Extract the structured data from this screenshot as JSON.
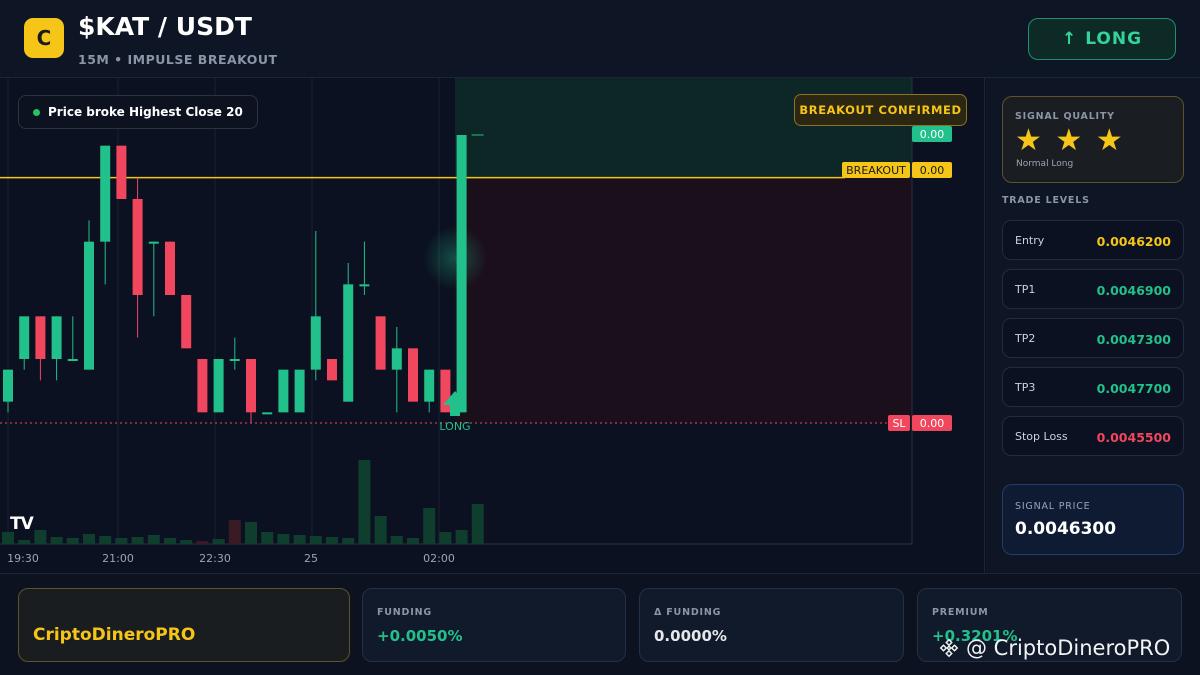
{
  "header": {
    "logo_letter": "C",
    "pair": "$KAT / USDT",
    "subtitle": "15M • IMPULSE BREAKOUT",
    "action_button": {
      "arrow": "↑",
      "label": "LONG"
    }
  },
  "chart": {
    "note": "Price broke Highest Close 20",
    "badge": "BREAKOUT CONFIRMED",
    "tv_logo": "TV",
    "tags": {
      "top_value": "0.00",
      "breakout_label": "BREAKOUT",
      "breakout_value": "0.00",
      "sl_label": "SL",
      "sl_value": "0.00"
    },
    "signal_marker_label": "LONG",
    "x_ticks": [
      "19:30",
      "21:00",
      "22:30",
      "25",
      "02:00"
    ],
    "colors": {
      "up": "#22c08a",
      "down": "#f0475e",
      "breakout_line": "#f5c518",
      "sl_line": "#f0475e"
    }
  },
  "chart_data": {
    "type": "candlestick",
    "x_ticks": [
      "19:30",
      "21:00",
      "22:30",
      "25",
      "02:00"
    ],
    "candles": [
      {
        "o": 0.00457,
        "h": 0.0046,
        "l": 0.00456,
        "c": 0.0046,
        "dir": "up"
      },
      {
        "o": 0.00461,
        "h": 0.00464,
        "l": 0.0046,
        "c": 0.00465,
        "dir": "up"
      },
      {
        "o": 0.00465,
        "h": 0.00465,
        "l": 0.00459,
        "c": 0.00461,
        "dir": "down"
      },
      {
        "o": 0.00461,
        "h": 0.00465,
        "l": 0.00459,
        "c": 0.00465,
        "dir": "up"
      },
      {
        "o": 0.00461,
        "h": 0.00465,
        "l": 0.00461,
        "c": 0.00461,
        "dir": "up"
      },
      {
        "o": 0.0046,
        "h": 0.00474,
        "l": 0.0046,
        "c": 0.00472,
        "dir": "up"
      },
      {
        "o": 0.00472,
        "h": 0.0048,
        "l": 0.00468,
        "c": 0.00481,
        "dir": "up"
      },
      {
        "o": 0.00481,
        "h": 0.00481,
        "l": 0.00476,
        "c": 0.00476,
        "dir": "down"
      },
      {
        "o": 0.00476,
        "h": 0.00478,
        "l": 0.00463,
        "c": 0.00467,
        "dir": "down"
      },
      {
        "o": 0.00472,
        "h": 0.00472,
        "l": 0.00465,
        "c": 0.00472,
        "dir": "up"
      },
      {
        "o": 0.00472,
        "h": 0.00472,
        "l": 0.00467,
        "c": 0.00467,
        "dir": "down"
      },
      {
        "o": 0.00467,
        "h": 0.00467,
        "l": 0.00462,
        "c": 0.00462,
        "dir": "down"
      },
      {
        "o": 0.00461,
        "h": 0.00461,
        "l": 0.00459,
        "c": 0.00456,
        "dir": "down"
      },
      {
        "o": 0.00461,
        "h": 0.00461,
        "l": 0.0046,
        "c": 0.00456,
        "dir": "up"
      },
      {
        "o": 0.00461,
        "h": 0.00463,
        "l": 0.0046,
        "c": 0.00461,
        "dir": "up"
      },
      {
        "o": 0.00461,
        "h": 0.00461,
        "l": 0.00455,
        "c": 0.00456,
        "dir": "down"
      },
      {
        "o": 0.00456,
        "h": 0.00456,
        "l": 0.00456,
        "c": 0.00456,
        "dir": "up"
      },
      {
        "o": 0.00456,
        "h": 0.0046,
        "l": 0.00456,
        "c": 0.0046,
        "dir": "up"
      },
      {
        "o": 0.00456,
        "h": 0.0046,
        "l": 0.00456,
        "c": 0.0046,
        "dir": "up"
      },
      {
        "o": 0.0046,
        "h": 0.00473,
        "l": 0.00459,
        "c": 0.00465,
        "dir": "up"
      },
      {
        "o": 0.00461,
        "h": 0.00461,
        "l": 0.00459,
        "c": 0.00459,
        "dir": "down"
      },
      {
        "o": 0.00457,
        "h": 0.0047,
        "l": 0.00457,
        "c": 0.00468,
        "dir": "up"
      },
      {
        "o": 0.00468,
        "h": 0.00472,
        "l": 0.00467,
        "c": 0.00468,
        "dir": "up"
      },
      {
        "o": 0.00465,
        "h": 0.00465,
        "l": 0.0046,
        "c": 0.0046,
        "dir": "down"
      },
      {
        "o": 0.00462,
        "h": 0.00464,
        "l": 0.00456,
        "c": 0.0046,
        "dir": "up"
      },
      {
        "o": 0.00462,
        "h": 0.00462,
        "l": 0.00457,
        "c": 0.00457,
        "dir": "down"
      },
      {
        "o": 0.0046,
        "h": 0.0046,
        "l": 0.00456,
        "c": 0.00457,
        "dir": "up"
      },
      {
        "o": 0.0046,
        "h": 0.0046,
        "l": 0.00456,
        "c": 0.00456,
        "dir": "down"
      },
      {
        "o": 0.00456,
        "h": 0.00482,
        "l": 0.00456,
        "c": 0.00482,
        "dir": "up"
      }
    ],
    "breakout_level": 0.00478,
    "stop_loss": 0.00455,
    "signal_label": "LONG"
  },
  "right_panel": {
    "quality_label": "SIGNAL QUALITY",
    "stars": "★ ★ ★",
    "quality_sub": "Normal Long",
    "levels_title": "TRADE LEVELS",
    "levels": [
      {
        "name": "Entry",
        "value": "0.0046200",
        "color": "#f5c518"
      },
      {
        "name": "TP1",
        "value": "0.0046900",
        "color": "#22c08a"
      },
      {
        "name": "TP2",
        "value": "0.0047300",
        "color": "#22c08a"
      },
      {
        "name": "TP3",
        "value": "0.0047700",
        "color": "#22c08a"
      },
      {
        "name": "Stop Loss",
        "value": "0.0045500",
        "color": "#f0475e"
      }
    ],
    "signal_price_label": "SIGNAL PRICE",
    "signal_price": "0.0046300"
  },
  "bottom": {
    "brand": "CriptoDineroPRO",
    "stats": [
      {
        "label": "FUNDING",
        "value": "+0.0050%",
        "color": "#22c08a"
      },
      {
        "label": "Δ FUNDING",
        "value": "0.0000%",
        "color": "#e5e7eb"
      },
      {
        "label": "PREMIUM",
        "value": "+0.3201%",
        "color": "#22c08a"
      }
    ],
    "watermark": "@ CriptoDineroPRO"
  }
}
